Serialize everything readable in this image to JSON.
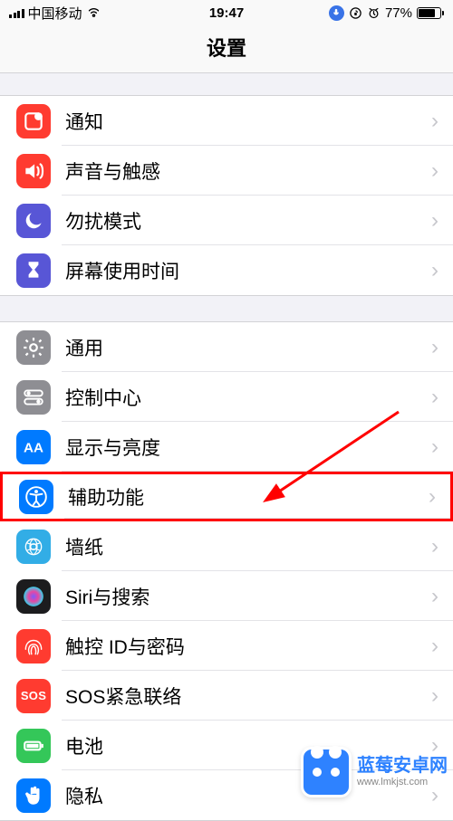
{
  "status": {
    "carrier": "中国移动",
    "time": "19:47",
    "battery_pct": "77%"
  },
  "header": {
    "title": "设置"
  },
  "groups": [
    {
      "items": [
        {
          "id": "notifications",
          "label": "通知",
          "icon": "notifications-icon",
          "bg": "bg-red"
        },
        {
          "id": "sounds",
          "label": "声音与触感",
          "icon": "sound-icon",
          "bg": "bg-red"
        },
        {
          "id": "dnd",
          "label": "勿扰模式",
          "icon": "moon-icon",
          "bg": "bg-purple"
        },
        {
          "id": "screentime",
          "label": "屏幕使用时间",
          "icon": "hourglass-icon",
          "bg": "bg-purple"
        }
      ]
    },
    {
      "items": [
        {
          "id": "general",
          "label": "通用",
          "icon": "gear-icon",
          "bg": "bg-gray"
        },
        {
          "id": "controlcenter",
          "label": "控制中心",
          "icon": "switches-icon",
          "bg": "bg-gray"
        },
        {
          "id": "display",
          "label": "显示与亮度",
          "icon": "brightness-icon",
          "bg": "bg-blue"
        },
        {
          "id": "accessibility",
          "label": "辅助功能",
          "icon": "accessibility-icon",
          "bg": "bg-blue",
          "highlight": true
        },
        {
          "id": "wallpaper",
          "label": "墙纸",
          "icon": "wallpaper-icon",
          "bg": "bg-cyan"
        },
        {
          "id": "siri",
          "label": "Siri与搜索",
          "icon": "siri-icon",
          "bg": "bg-black"
        },
        {
          "id": "touchid",
          "label": "触控 ID与密码",
          "icon": "fingerprint-icon",
          "bg": "bg-red"
        },
        {
          "id": "sos",
          "label": "SOS紧急联络",
          "icon": "sos-icon",
          "bg": "bg-red",
          "text_icon": "SOS"
        },
        {
          "id": "battery",
          "label": "电池",
          "icon": "battery-icon",
          "bg": "bg-green"
        },
        {
          "id": "privacy",
          "label": "隐私",
          "icon": "hand-icon",
          "bg": "bg-blue"
        }
      ]
    }
  ],
  "watermark": {
    "line1": "蓝莓安卓网",
    "line2": "www.lmkjst.com"
  }
}
